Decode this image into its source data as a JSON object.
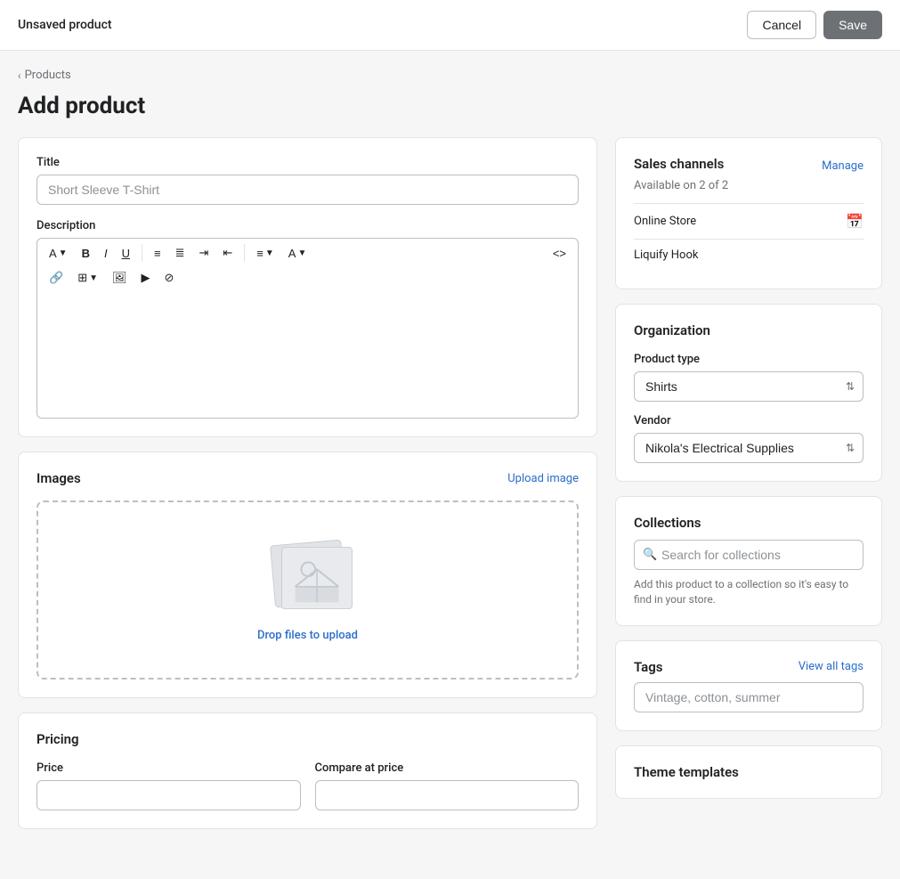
{
  "topbar": {
    "title": "Unsaved product",
    "cancel_label": "Cancel",
    "save_label": "Save"
  },
  "breadcrumb": {
    "label": "Products",
    "arrow": "‹"
  },
  "page": {
    "title": "Add product"
  },
  "title_field": {
    "label": "Title",
    "placeholder": "Short Sleeve T-Shirt"
  },
  "description_field": {
    "label": "Description"
  },
  "toolbar": {
    "font_btn": "A",
    "bold_btn": "B",
    "italic_btn": "I",
    "underline_btn": "U",
    "ul_btn": "☰",
    "ol_btn": "≡",
    "indent_btn": "⇥",
    "outdent_btn": "⇤",
    "align_btn": "≡",
    "color_btn": "A",
    "code_btn": "<>",
    "link_btn": "🔗",
    "table_btn": "⊞",
    "image_btn": "🖼",
    "video_btn": "▶",
    "clear_btn": "⊘"
  },
  "images": {
    "title": "Images",
    "upload_label": "Upload image",
    "drop_text": "Drop files to upload"
  },
  "pricing": {
    "title": "Pricing",
    "price_label": "Price",
    "compare_label": "Compare at price"
  },
  "sales_channels": {
    "title": "Sales channels",
    "manage_label": "Manage",
    "availability": "Available on 2 of 2",
    "channels": [
      {
        "name": "Online Store",
        "icon": "📅"
      },
      {
        "name": "Liquify Hook",
        "icon": ""
      }
    ]
  },
  "organization": {
    "title": "Organization",
    "product_type_label": "Product type",
    "product_type_value": "Shirts",
    "vendor_label": "Vendor",
    "vendor_value": "Nikola's Electrical Supplies"
  },
  "collections": {
    "title": "Collections",
    "search_placeholder": "Search for collections",
    "hint": "Add this product to a collection so it's easy to find in your store."
  },
  "tags": {
    "title": "Tags",
    "view_all_label": "View all tags",
    "placeholder": "Vintage, cotton, summer"
  },
  "theme_templates": {
    "title": "Theme templates"
  }
}
